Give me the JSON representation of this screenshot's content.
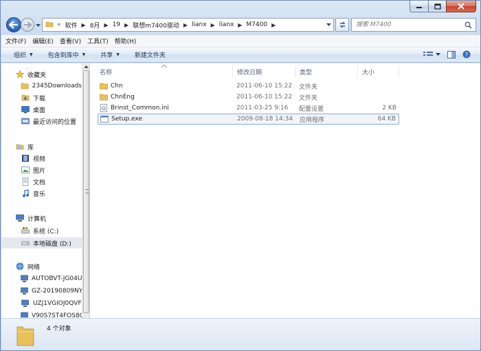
{
  "address": {
    "lead": "«",
    "crumbs": [
      "软件",
      "8月",
      "19",
      "联想m7400驱动",
      "lianx",
      "lianx",
      "M7400"
    ]
  },
  "search": {
    "placeholder": "搜索 M7400"
  },
  "menubar": [
    {
      "label": "文件(F)"
    },
    {
      "label": "编辑(E)"
    },
    {
      "label": "查看(V)"
    },
    {
      "label": "工具(T)"
    },
    {
      "label": "帮助(H)"
    }
  ],
  "toolbar": {
    "organize": "组织",
    "include_library": "包含到库中",
    "share": "共享",
    "new_folder": "新建文件夹"
  },
  "navpane": {
    "favorites": {
      "label": "收藏夹",
      "items": [
        "2345Downloads",
        "下载",
        "桌面",
        "最近访问的位置"
      ]
    },
    "libraries": {
      "label": "库",
      "items": [
        "视频",
        "图片",
        "文档",
        "音乐"
      ]
    },
    "computer": {
      "label": "计算机",
      "items": [
        "系统 (C:)",
        "本地磁盘 (D:)"
      ],
      "selected": "本地磁盘 (D:)"
    },
    "network": {
      "label": "网络",
      "items": [
        "AUTOBVT-JG04U",
        "GZ-20190809NY",
        "UZJ1VGIOJ0QVF",
        "V90S7ST4FOS8C"
      ]
    }
  },
  "columns": {
    "name": "名称",
    "date": "修改日期",
    "type": "类型",
    "size": "大小"
  },
  "files": [
    {
      "name": "Chn",
      "date": "2011-06-10 15:22",
      "type": "文件夹",
      "size": "",
      "icon": "folder-icon"
    },
    {
      "name": "ChnEng",
      "date": "2011-06-10 15:22",
      "type": "文件夹",
      "size": "",
      "icon": "folder-icon"
    },
    {
      "name": "Brinst_Common.ini",
      "date": "2011-03-25 9:16",
      "type": "配置设置",
      "size": "2 KB",
      "icon": "ini-file-icon"
    },
    {
      "name": "Setup.exe",
      "date": "2009-08-18 14:34",
      "type": "应用程序",
      "size": "64 KB",
      "icon": "exe-file-icon"
    }
  ],
  "selected_file": "Setup.exe",
  "status": {
    "text": "4 个对象"
  },
  "colors": {
    "accent": "#2b62b5",
    "selection_border": "#84acdd",
    "folder": "#e8c15a"
  }
}
